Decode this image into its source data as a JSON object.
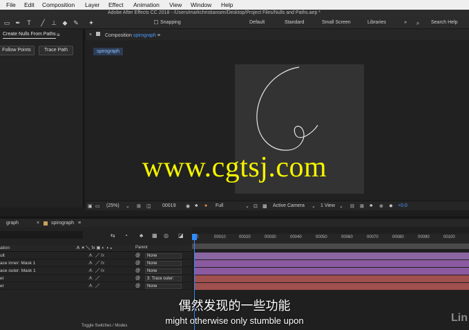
{
  "menu": [
    "File",
    "Edit",
    "Composition",
    "Layer",
    "Effect",
    "Animation",
    "View",
    "Window",
    "Help"
  ],
  "window_title": "Adobe After Effects CC 2018 - /Users/markchristiansen/Desktop/Project Files/Nulls and Paths.aep *",
  "toolbar": {
    "snapping": "Snapping",
    "workspaces": [
      "Default",
      "Standard",
      "Small Screen",
      "Libraries"
    ],
    "search_help": "Search Help"
  },
  "left_panel": {
    "title": "Create Nulls From Paths",
    "buttons": [
      "Follow Points",
      "Trace Path"
    ]
  },
  "composition": {
    "label": "Composition",
    "name": "spirograph",
    "chip": "spirograph"
  },
  "viewer": {
    "zoom": "(25%)",
    "timecode": "00019",
    "resolution": "Full",
    "camera": "Active Camera",
    "views": "1 View",
    "exposure": "+0.0"
  },
  "timeline": {
    "tabs": [
      "graph",
      "spirograph"
    ],
    "column_source": "ation",
    "column_parent": "Parent",
    "ruler_ticks": [
      "00010",
      "00020",
      "00030",
      "00040",
      "00050",
      "00060",
      "00070",
      "00080",
      "00090",
      "00100"
    ],
    "ruler_start": "0",
    "layers": [
      {
        "name": "ult",
        "fx": "fx",
        "parent": "None",
        "color": "#8a66a3"
      },
      {
        "name": "ace inner: Mask 1",
        "fx": "fx",
        "parent": "None",
        "color": "#8c5aa0"
      },
      {
        "name": "ace outer: Mask 1",
        "fx": "fx",
        "parent": "None",
        "color": "#8c5aa0"
      },
      {
        "name": "er",
        "fx": "",
        "parent": "3. Trace outer:",
        "color": "#a0504e"
      },
      {
        "name": "er",
        "fx": "",
        "parent": "None",
        "color": "#a0504e"
      }
    ],
    "toggle_label": "Toggle Switches / Modes"
  },
  "overlay": {
    "watermark": "www.cgtsj.com",
    "subtitle_cn": "偶然发现的一些功能",
    "subtitle_en": "might otherwise only stumble upon",
    "brand": "Lin"
  }
}
